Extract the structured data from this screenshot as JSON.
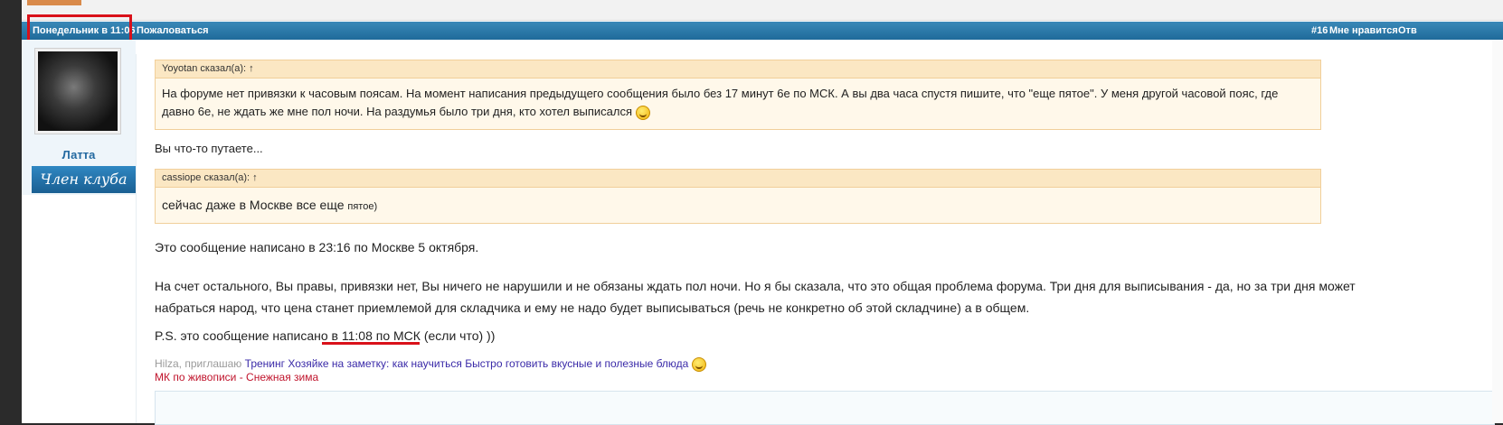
{
  "header": {
    "date": "Понедельник в 11:06",
    "report": "Пожаловаться",
    "post_number": "#16",
    "like": "Мне нравится",
    "reply": "Отв"
  },
  "user": {
    "name": "Латта",
    "rank": "Член клуба"
  },
  "quotes": [
    {
      "header": "Yoyotan сказал(а): ↑",
      "body": "На форуме нет привязки к часовым поясам. На момент написания предыдущего сообщения было без 17 минут 6е по МСК. А вы два часа спустя пишите, что \"еще пятое\". У меня другой часовой пояс, где давно 6е, не ждать же мне пол ночи. На раздумья было три дня, кто хотел выписался"
    },
    {
      "header": "cassiope сказал(а): ↑",
      "body_large": "сейчас даже в Москве все еще",
      "body_small": "пятое)"
    }
  ],
  "message": {
    "line1": "Вы что-то путаете...",
    "line2": "Это сообщение написано в 23:16 по Москве 5 октября.",
    "line3": "На счет остального, Вы правы, привязки нет, Вы ничего не нарушили и не обязаны ждать пол ночи. Но я бы сказала, что это общая проблема форума. Три дня для выписывания - да, но за три дня может набраться народ, что цена станет приемлемой для складчика и ему не надо будет выписываться (речь не конкретно об этой складчине) а в общем.",
    "line4": "P.S. это сообщение написано в 11:08 по МСК (если что) ))"
  },
  "signature": {
    "prefix": "Hilza, приглашаю",
    "link1": "Тренинг Хозяйке на заметку: как научиться Быстро готовить вкусные и полезные блюда",
    "link2": "МК по живописи - Снежная зима"
  },
  "colors": {
    "header_bar": "#1f6a9a",
    "highlight": "#d9111a",
    "quote_bg": "#fff8ea",
    "username": "#2369a0"
  }
}
